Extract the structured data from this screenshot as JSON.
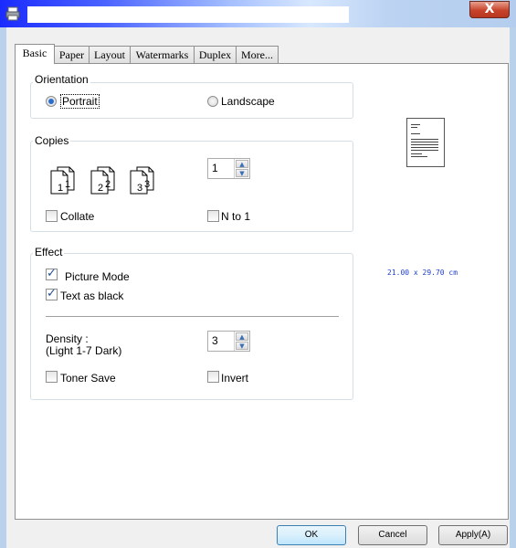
{
  "window": {
    "close_label": "X"
  },
  "tabs": [
    {
      "label": "Basic",
      "active": true
    },
    {
      "label": "Paper",
      "active": false
    },
    {
      "label": "Layout",
      "active": false
    },
    {
      "label": "Watermarks",
      "active": false
    },
    {
      "label": "Duplex",
      "active": false
    },
    {
      "label": "More...",
      "active": false
    }
  ],
  "orientation": {
    "title": "Orientation",
    "portrait_label": "Portrait",
    "landscape_label": "Landscape",
    "selected": "Portrait"
  },
  "copies": {
    "title": "Copies",
    "value": "1",
    "collate_label": "Collate",
    "collate_checked": false,
    "nto1_label": "N to 1",
    "nto1_checked": false,
    "icon_labels": [
      "1",
      "1",
      "2",
      "2",
      "3",
      "3"
    ]
  },
  "effect": {
    "title": "Effect",
    "picture_mode_label": "Picture Mode",
    "picture_mode_checked": true,
    "text_as_black_label": "Text as black",
    "text_as_black_checked": true,
    "density_label_1": "Density :",
    "density_label_2": "(Light 1-7 Dark)",
    "density_value": "3",
    "toner_save_label": "Toner Save",
    "toner_save_checked": false,
    "invert_label": "Invert",
    "invert_checked": false
  },
  "preview": {
    "paper_size": "21.00 x 29.70 cm"
  },
  "buttons": {
    "ok": "OK",
    "cancel": "Cancel",
    "apply": "Apply(A)"
  }
}
